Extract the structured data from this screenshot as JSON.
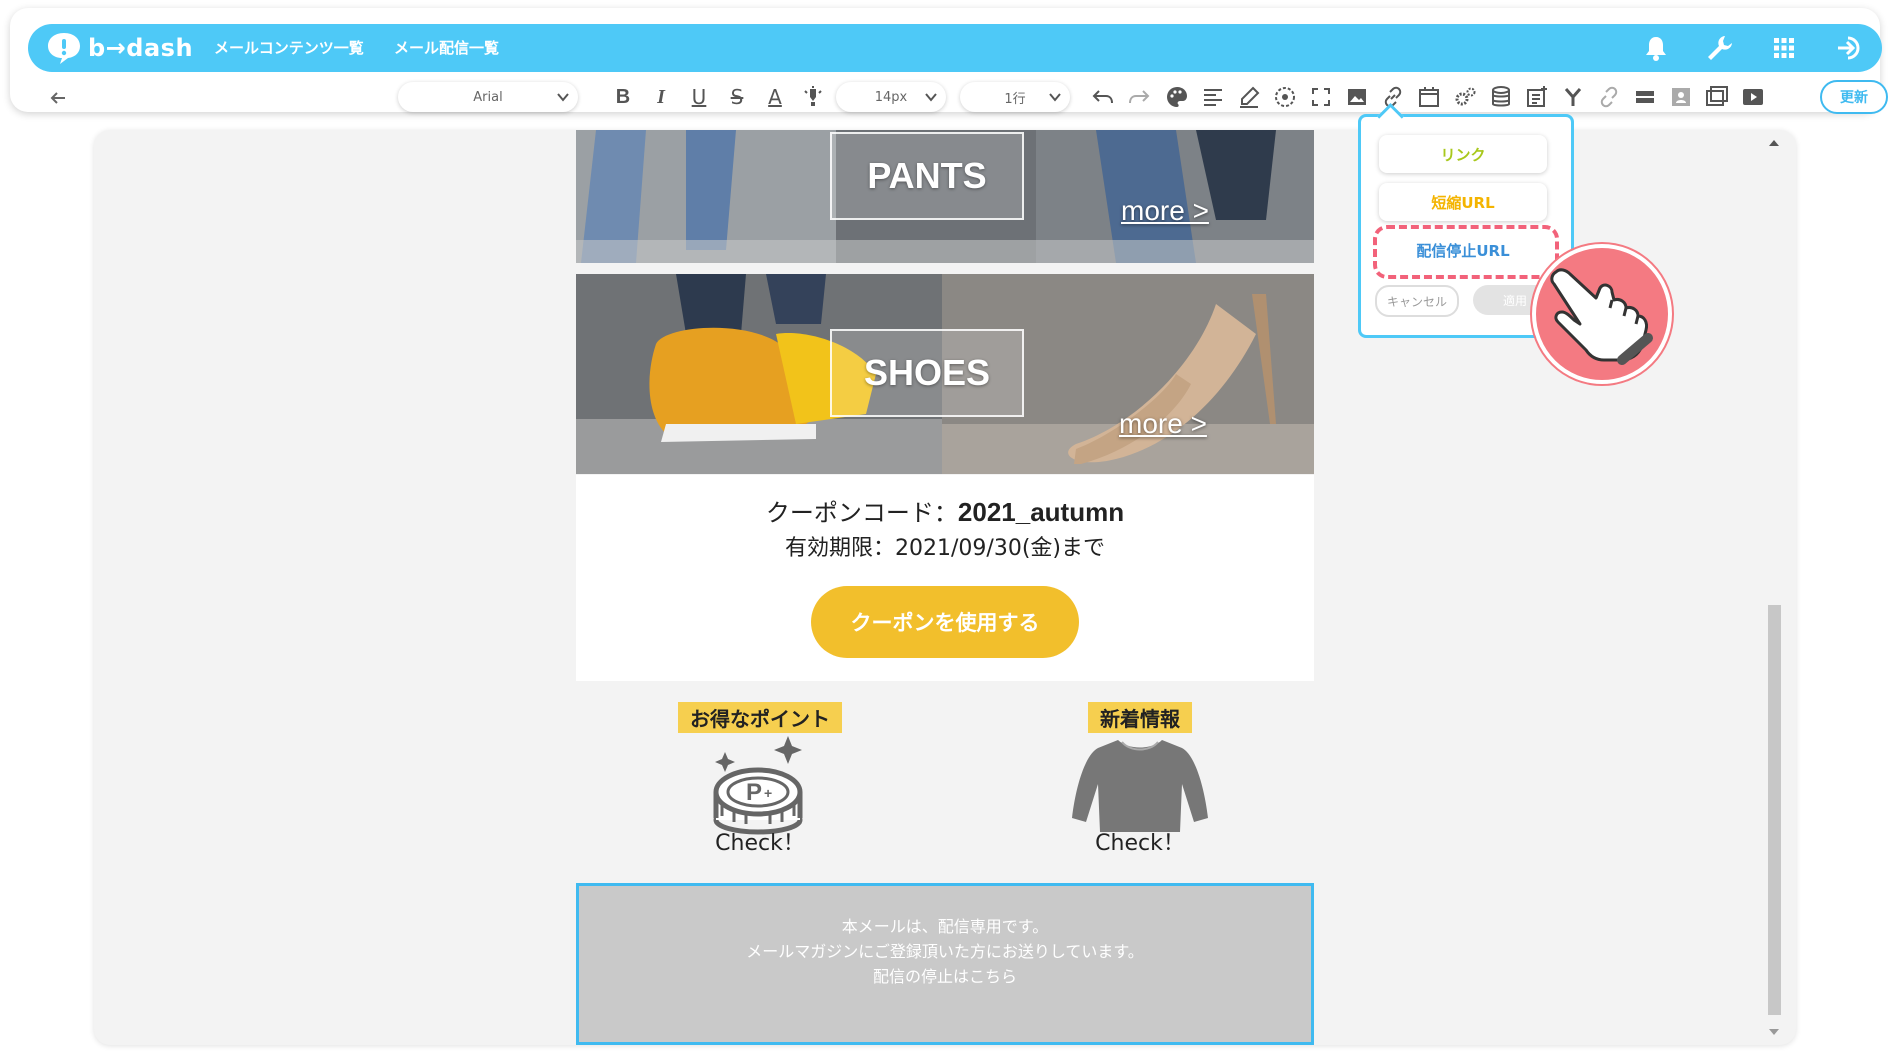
{
  "header": {
    "logo_text": "b→dash",
    "nav": [
      "メールコンテンツ一覧",
      "メール配信一覧"
    ],
    "icons": [
      "bell-icon",
      "wrench-icon",
      "apps-grid-icon",
      "logout-icon"
    ]
  },
  "toolbar": {
    "font_family": "Arial",
    "font_size": "14px",
    "line_height": "1行",
    "bold": "B",
    "italic": "I",
    "underline": "U",
    "strike": "S",
    "font_color": "A",
    "update_label": "更新"
  },
  "email": {
    "banners": [
      {
        "title": "PANTS",
        "more": "more >"
      },
      {
        "title": "SHOES",
        "more": "more >"
      }
    ],
    "coupon": {
      "code_label": "クーポンコード：",
      "code_value": "2021_autumn",
      "expiry": "有効期限：2021/09/30(金)まで",
      "button": "クーポンを使用する"
    },
    "features": [
      {
        "label": "お得なポイント",
        "check": "Check！",
        "icon": "point-coin-icon"
      },
      {
        "label": "新着情報",
        "check": "Check！",
        "icon": "sweater-icon"
      }
    ],
    "footer": {
      "line1": "本メールは、配信専用です。",
      "line2": "メールマガジンにご登録頂いた方にお送りしています。",
      "line3": "配信の停止はこちら"
    }
  },
  "link_popover": {
    "items": [
      "リンク",
      "短縮URL",
      "配信停止URL"
    ],
    "item_colors": [
      "#a8c81c",
      "#f4b400",
      "#3a8fd8"
    ],
    "cancel": "キャンセル",
    "apply": "適用"
  },
  "colors": {
    "brand": "#4ec9f7",
    "coupon_button": "#f2bf2c",
    "highlight": "#f2627a"
  }
}
